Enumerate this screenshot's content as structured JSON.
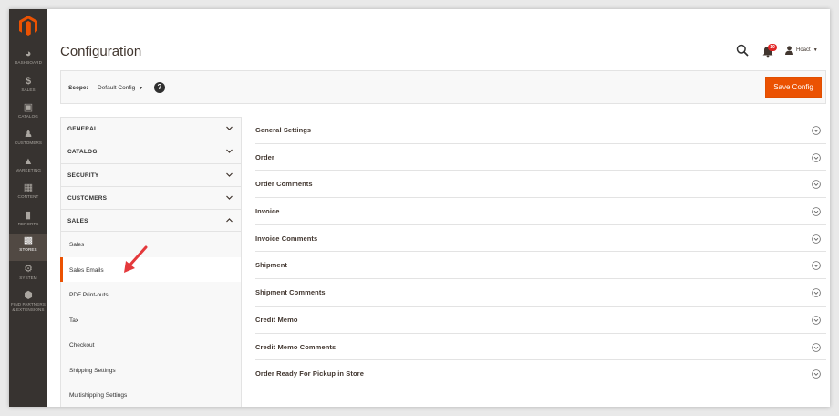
{
  "nav": {
    "items": [
      {
        "label": "DASHBOARD",
        "icon": "dashboard-icon",
        "active": false
      },
      {
        "label": "SALES",
        "icon": "dollar-icon",
        "active": false
      },
      {
        "label": "CATALOG",
        "icon": "box-icon",
        "active": false
      },
      {
        "label": "CUSTOMERS",
        "icon": "person-icon",
        "active": false
      },
      {
        "label": "MARKETING",
        "icon": "megaphone-icon",
        "active": false
      },
      {
        "label": "CONTENT",
        "icon": "content-icon",
        "active": false
      },
      {
        "label": "REPORTS",
        "icon": "bar-chart-icon",
        "active": false
      },
      {
        "label": "STORES",
        "icon": "store-icon",
        "active": true
      },
      {
        "label": "SYSTEM",
        "icon": "gear-icon",
        "active": false
      },
      {
        "label": "FIND PARTNERS",
        "label2": "& EXTENSIONS",
        "icon": "extensions-icon",
        "active": false
      }
    ]
  },
  "header": {
    "title": "Configuration",
    "notifications_count": "10",
    "user_name": "Hoact"
  },
  "scope": {
    "label": "Scope:",
    "value": "Default Config",
    "help": "?",
    "save_label": "Save Config"
  },
  "sidebar": {
    "sections": [
      "GENERAL",
      "CATALOG",
      "SECURITY",
      "CUSTOMERS",
      "SALES"
    ],
    "sales_items": [
      {
        "label": "Sales",
        "active": false
      },
      {
        "label": "Sales Emails",
        "active": true
      },
      {
        "label": "PDF Print-outs",
        "active": false
      },
      {
        "label": "Tax",
        "active": false
      },
      {
        "label": "Checkout",
        "active": false
      },
      {
        "label": "Shipping Settings",
        "active": false
      },
      {
        "label": "Multishipping Settings",
        "active": false
      }
    ]
  },
  "groups": [
    "General Settings",
    "Order",
    "Order Comments",
    "Invoice",
    "Invoice Comments",
    "Shipment",
    "Shipment Comments",
    "Credit Memo",
    "Credit Memo Comments",
    "Order Ready For Pickup in Store"
  ],
  "colors": {
    "accent": "#eb5202",
    "rail": "#373330",
    "rail_active": "#514943",
    "badge": "#e22626"
  }
}
